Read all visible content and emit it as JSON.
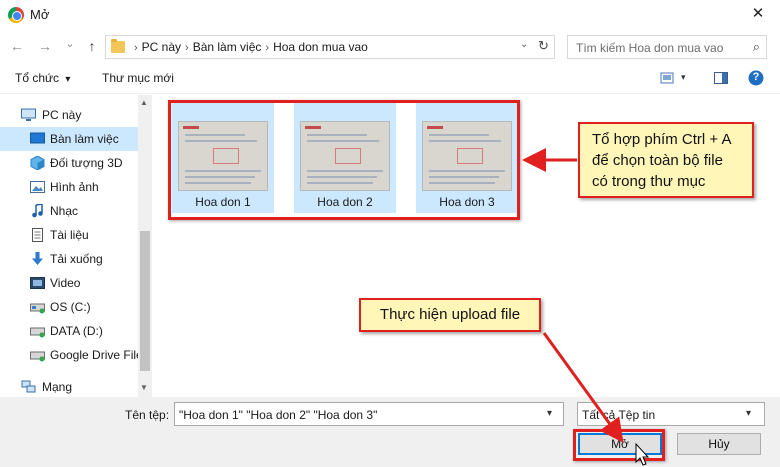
{
  "window": {
    "title": "Mở",
    "close_glyph": "✕"
  },
  "nav": {
    "back_glyph": "←",
    "forward_glyph": "→",
    "history_glyph": "⌄",
    "up_glyph": "↑",
    "breadcrumb": [
      "PC này",
      "Bàn làm việc",
      "Hoa don mua vao"
    ],
    "breadcrumb_sep": "›",
    "dropdown_glyph": "⌄",
    "refresh_glyph": "↻",
    "search_placeholder": "Tìm kiếm Hoa don mua vao",
    "search_glyph": "⌕"
  },
  "toolbar": {
    "organize_label": "Tổ chức",
    "organize_caret": "▾",
    "new_folder_label": "Thư mục mới",
    "help_glyph": "?"
  },
  "sidebar": {
    "root": "PC này",
    "items": [
      {
        "label": "Bàn làm việc",
        "icon": "desktop-icon",
        "selected": true
      },
      {
        "label": "Đối tượng 3D",
        "icon": "cube-icon"
      },
      {
        "label": "Hình ảnh",
        "icon": "pictures-icon"
      },
      {
        "label": "Nhạc",
        "icon": "music-icon"
      },
      {
        "label": "Tài liệu",
        "icon": "document-icon"
      },
      {
        "label": "Tải xuống",
        "icon": "download-icon"
      },
      {
        "label": "Video",
        "icon": "video-icon"
      },
      {
        "label": "OS (C:)",
        "icon": "drive-icon"
      },
      {
        "label": "DATA (D:)",
        "icon": "drive-icon"
      },
      {
        "label": "Google Drive File",
        "icon": "drive-icon"
      }
    ],
    "network": "Mạng"
  },
  "files": [
    {
      "name": "Hoa don 1",
      "selected": true
    },
    {
      "name": "Hoa don 2",
      "selected": true
    },
    {
      "name": "Hoa don 3",
      "selected": true
    }
  ],
  "annotations": {
    "select_all": [
      "Tổ hợp phím Ctrl + A",
      "để chọn toàn bộ file",
      "có trong thư mục"
    ],
    "upload": "Thực hiện upload file",
    "border_color": "#e01f1f",
    "callout_fill": "#fff6b8"
  },
  "bottom": {
    "filename_label": "Tên tệp:",
    "filename_value": "\"Hoa don 1\" \"Hoa don 2\" \"Hoa don 3\"",
    "filter_value": "Tất cả Tệp tin",
    "open_button": "Mở",
    "cancel_button": "Hủy"
  }
}
